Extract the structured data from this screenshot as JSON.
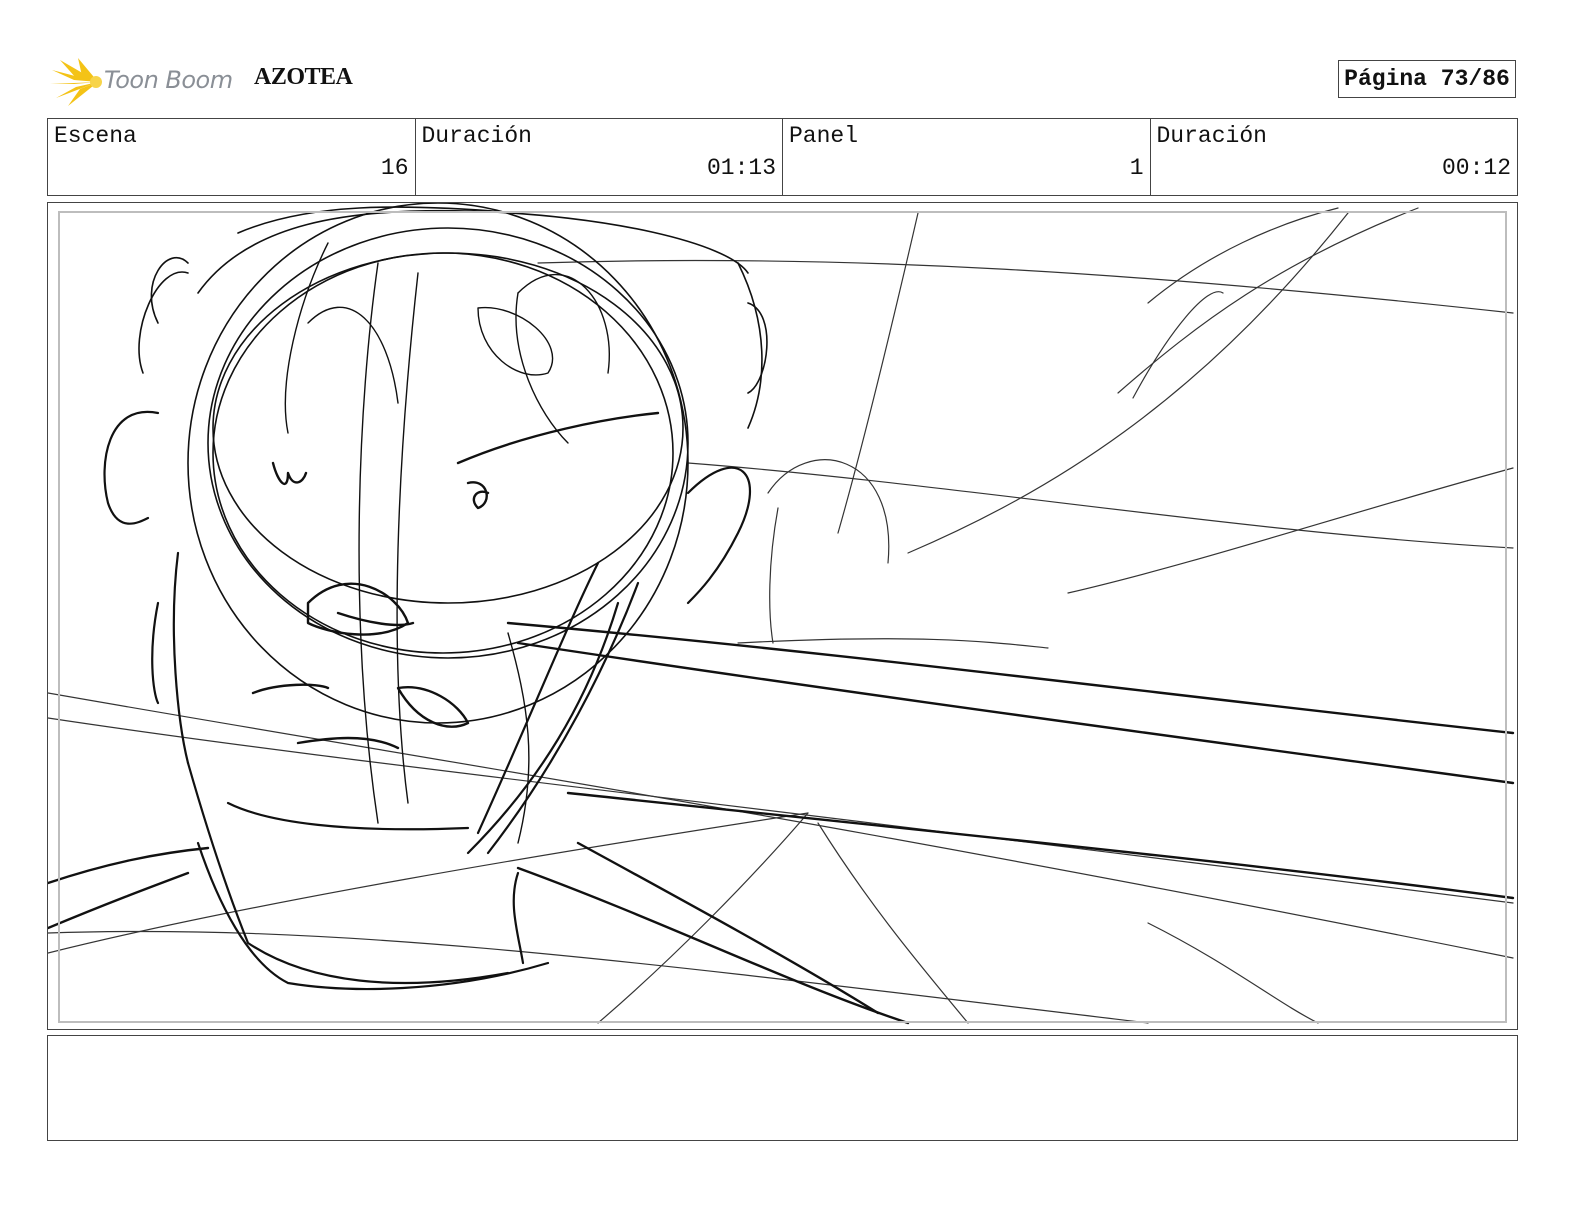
{
  "header": {
    "brand": "Toon Boom",
    "project_title": "AZOTEA",
    "page_label": "Página 73/86"
  },
  "info": {
    "scene_label": "Escena",
    "scene_value": "16",
    "scene_duration_label": "Duración",
    "scene_duration_value": "01:13",
    "panel_label": "Panel",
    "panel_value": "1",
    "panel_duration_label": "Duración",
    "panel_duration_value": "00:12"
  },
  "notes": {
    "text": ""
  },
  "colors": {
    "logo_burst": "#f4c316",
    "logo_text": "#8a8f96",
    "border": "#444444"
  }
}
